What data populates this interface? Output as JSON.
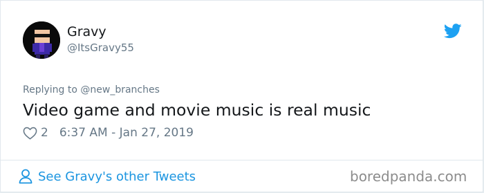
{
  "author": {
    "name": "Gravy",
    "handle": "@ItsGravy55"
  },
  "tweet": {
    "replying_to": "Replying to @new_branches",
    "text": "Video game and movie music is real music",
    "likes": "2",
    "timestamp": "6:37 AM - Jan 27, 2019"
  },
  "footer": {
    "link_label": "See Gravy's other Tweets",
    "watermark": "boredpanda.com"
  },
  "icons": {
    "brand": "twitter-bird-icon",
    "like": "heart-outline-icon",
    "profile": "person-outline-icon"
  },
  "colors": {
    "twitter_blue": "#1da1f2",
    "link_blue": "#1b95e0",
    "muted_text": "#657786",
    "main_text": "#14171a"
  }
}
